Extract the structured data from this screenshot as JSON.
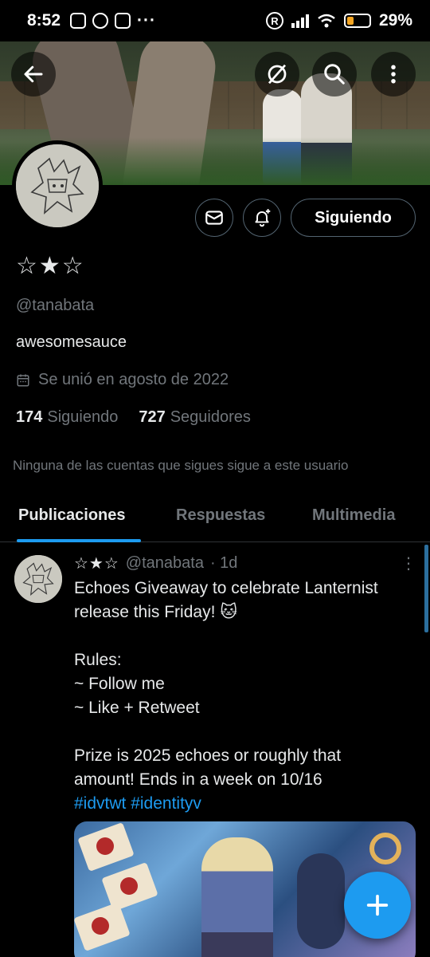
{
  "status_bar": {
    "time": "8:52",
    "battery": "29%",
    "more": "···",
    "r_badge": "R"
  },
  "profile": {
    "display_name": "☆★☆",
    "handle": "@tanabata",
    "bio": "awesomesauce",
    "joined": "Se unió en agosto de 2022",
    "following_count": "174",
    "following_label": "Siguiendo",
    "followers_count": "727",
    "followers_label": "Seguidores",
    "mutual_note": "Ninguna de las cuentas que sigues sigue a este usuario",
    "follow_button_label": "Siguiendo"
  },
  "tabs": [
    {
      "label": "Publicaciones",
      "active": true
    },
    {
      "label": "Respuestas",
      "active": false
    },
    {
      "label": "Multimedia",
      "active": false
    }
  ],
  "post": {
    "author_name": "☆★☆",
    "author_handle": "@tanabata",
    "time": "· 1d",
    "lines": [
      "Echoes Giveaway to celebrate Lanternist",
      "release this Friday! 🐱",
      "",
      "Rules:",
      "~ Follow me",
      "~ Like + Retweet",
      "",
      "Prize is 2025 echoes or roughly that",
      "amount! Ends in a week on 10/16"
    ],
    "hashtags": "#idvtwt #identityv",
    "more_icon": "⋮"
  },
  "icons": {
    "back": "back-arrow-icon",
    "grok": "grok-icon",
    "search": "search-icon",
    "menu": "more-vertical-icon",
    "message": "envelope-icon",
    "notify": "bell-plus-icon",
    "calendar": "calendar-icon",
    "compose": "plus-icon"
  },
  "colors": {
    "accent": "#1d9bf0",
    "muted": "#71767b",
    "text": "#e7e9ea",
    "background": "#000000"
  }
}
